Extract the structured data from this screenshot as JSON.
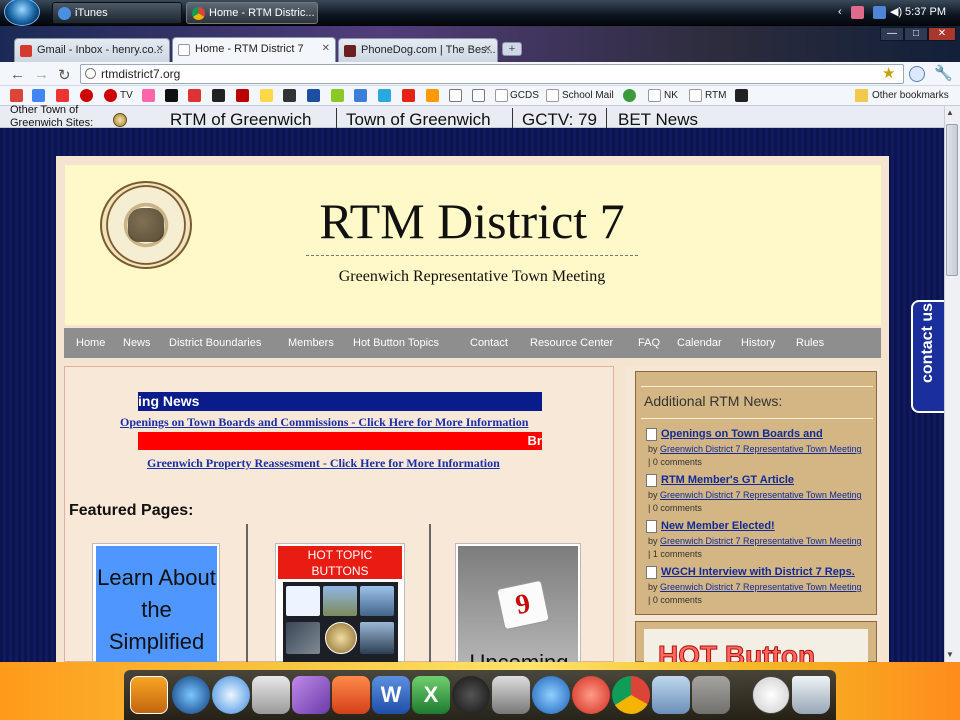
{
  "taskbar": {
    "tasks": [
      {
        "label": "iTunes"
      },
      {
        "label": "Home - RTM Distric..."
      }
    ],
    "clock": "5:37 PM"
  },
  "browser": {
    "tabs": [
      {
        "label": "Gmail - Inbox - henry.co..."
      },
      {
        "label": "Home - RTM District 7"
      },
      {
        "label": "PhoneDog.com | The Bes..."
      }
    ],
    "url": "rtmdistrict7.org",
    "bookmarks": {
      "tv": "TV",
      "gcds": "GCDS",
      "school_mail": "School Mail",
      "nk": "NK",
      "rtm": "RTM",
      "other": "Other bookmarks"
    }
  },
  "sites_bar": {
    "label": "Other Town of Greenwich Sites:",
    "links": [
      "RTM of Greenwich",
      "Town of Greenwich",
      "GCTV: 79",
      "BET News"
    ]
  },
  "header": {
    "title": "RTM District 7",
    "subtitle": "Greenwich Representative Town Meeting"
  },
  "nav": {
    "items": [
      "Home",
      "News",
      "District Boundaries",
      "Members",
      "Hot Button Topics",
      "Contact",
      "Resource Center",
      "FAQ",
      "Calendar",
      "History",
      "Rules"
    ]
  },
  "main": {
    "ticker1": "ing News",
    "link1": "Openings on Town Boards and Commissions - Click Here for More Information",
    "ticker2": "Br",
    "link2": "Greenwich Property Reassesment - Click Here for More Information",
    "featured_title": "Featured Pages:",
    "feature1": "Learn About the Simplified",
    "feature2_head": "HOT TOPIC BUTTONS",
    "feature3": "Upcoming"
  },
  "sidebar": {
    "news_title": "Additional RTM News:",
    "items": [
      {
        "title": "Openings on Town Boards and",
        "by_prefix": "by",
        "by": "Greenwich District 7 Representative Town Meeting",
        "comments": "| 0 comments"
      },
      {
        "title": "RTM Member's GT Article",
        "by_prefix": "by",
        "by": "Greenwich District 7 Representative Town Meeting",
        "comments": "| 0 comments"
      },
      {
        "title": "New Member Elected!",
        "by_prefix": "by",
        "by": "Greenwich District 7 Representative Town Meeting",
        "comments": "| 1 comments"
      },
      {
        "title": "WGCH Interview with District 7 Reps.",
        "by_prefix": "by",
        "by": "Greenwich District 7 Representative Town Meeting",
        "comments": "| 0 comments"
      }
    ],
    "hot_button": "HOT Button",
    "contact_tab": "contact us"
  },
  "colors": {
    "accent_blue": "#1a2fa8",
    "ticker_blue": "#0a1b8c",
    "ticker_red": "#ff0000",
    "nav_gray": "#8e8e8e",
    "banner_yellow": "#fff8c8"
  }
}
